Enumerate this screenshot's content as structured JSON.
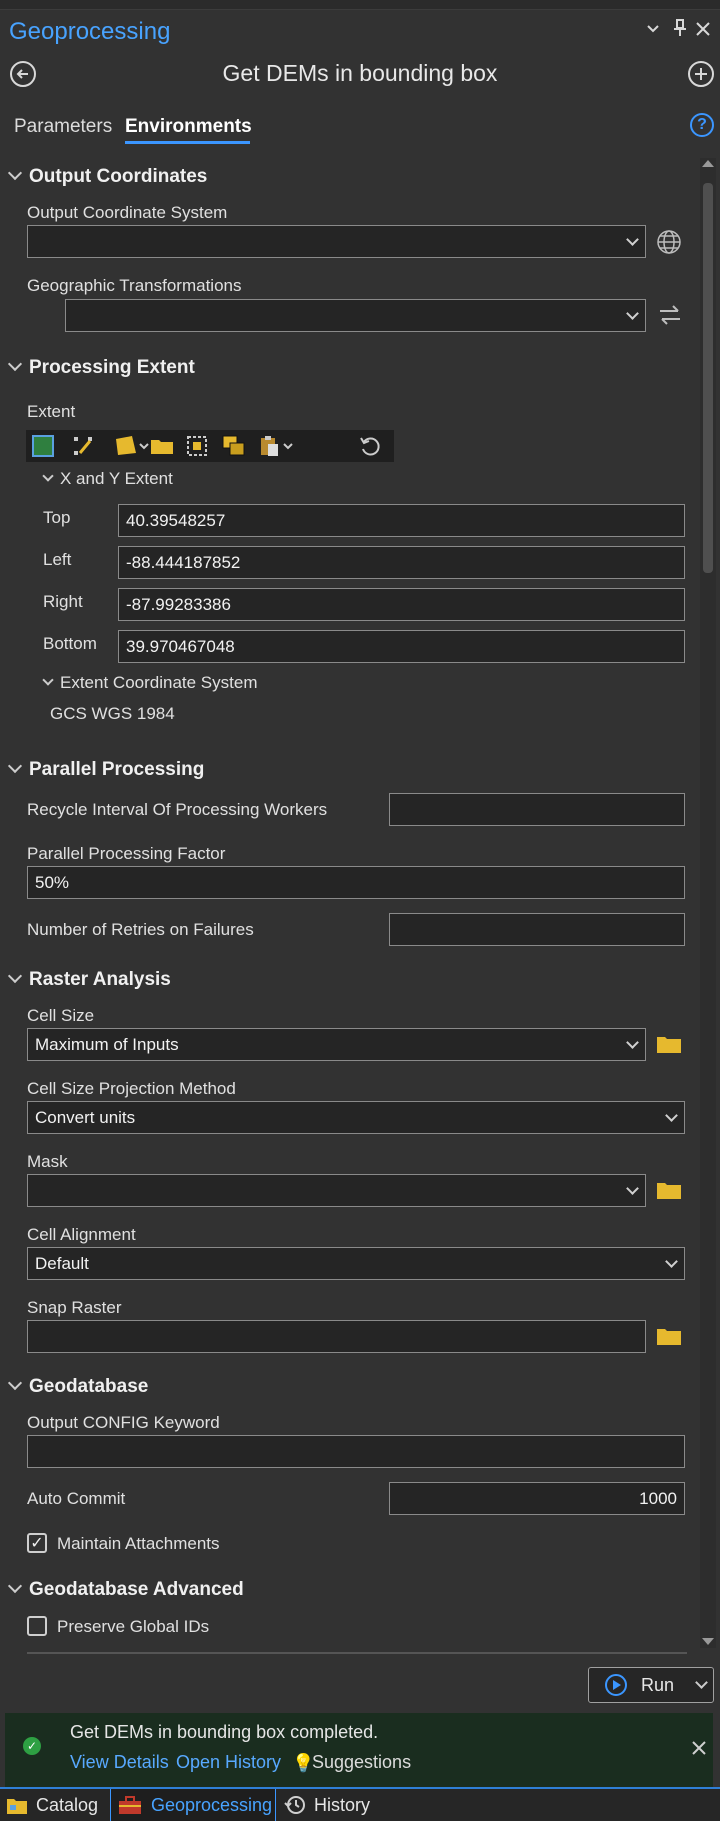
{
  "header": {
    "title": "Geoprocessing",
    "pin_icon": "pin-icon",
    "close_icon": "close-icon",
    "menu_icon": "chevron-down-icon"
  },
  "tool": {
    "title": "Get DEMs in bounding box"
  },
  "tabs": [
    {
      "label": "Parameters"
    },
    {
      "label": "Environments"
    }
  ],
  "sections": {
    "output_coordinates": {
      "title": "Output Coordinates",
      "ocs_label": "Output Coordinate System",
      "ocs_value": "",
      "gt_label": "Geographic Transformations",
      "gt_value": ""
    },
    "processing_extent": {
      "title": "Processing Extent",
      "extent_label": "Extent",
      "xy_title": "X and Y Extent",
      "top_label": "Top",
      "top_value": "40.39548257",
      "left_label": "Left",
      "left_value": "-88.444187852",
      "right_label": "Right",
      "right_value": "-87.99283386",
      "bottom_label": "Bottom",
      "bottom_value": "39.970467048",
      "ecs_title": "Extent Coordinate System",
      "ecs_value": "GCS WGS 1984"
    },
    "parallel": {
      "title": "Parallel Processing",
      "recycle_label": "Recycle Interval Of Processing Workers",
      "recycle_value": "",
      "factor_label": "Parallel Processing Factor",
      "factor_value": "50%",
      "retries_label": "Number of Retries on Failures",
      "retries_value": ""
    },
    "raster": {
      "title": "Raster Analysis",
      "cell_size_label": "Cell Size",
      "cell_size_value": "Maximum of Inputs",
      "projection_label": "Cell Size Projection Method",
      "projection_value": "Convert units",
      "mask_label": "Mask",
      "mask_value": "",
      "alignment_label": "Cell Alignment",
      "alignment_value": "Default",
      "snap_label": "Snap Raster",
      "snap_value": ""
    },
    "geodatabase": {
      "title": "Geodatabase",
      "config_label": "Output CONFIG Keyword",
      "config_value": "",
      "autocommit_label": "Auto Commit",
      "autocommit_value": "1000",
      "attachments_label": "Maintain Attachments",
      "attachments_checked": true
    },
    "gdb_advanced": {
      "title": "Geodatabase Advanced",
      "global_ids_label": "Preserve Global IDs",
      "global_ids_checked": false
    }
  },
  "run": {
    "label": "Run"
  },
  "notification": {
    "message": "Get DEMs in bounding box completed.",
    "view_details": "View Details",
    "open_history": "Open History",
    "suggestions": "Suggestions"
  },
  "bottom_tabs": [
    {
      "label": "Catalog"
    },
    {
      "label": "Geoprocessing"
    },
    {
      "label": "History"
    }
  ],
  "colors": {
    "accent": "#48a3ff",
    "success": "#2ea043",
    "folder": "#e6b92e"
  }
}
